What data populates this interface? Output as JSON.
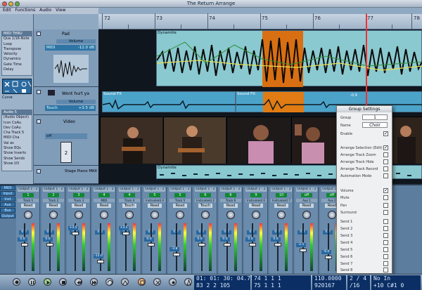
{
  "window": {
    "title": "The Return Arrange"
  },
  "menu": {
    "items": [
      "Edit",
      "Functions",
      "Audio",
      "View"
    ]
  },
  "ruler": {
    "bars": [
      "72",
      "73",
      "74",
      "75",
      "76",
      "77",
      "78"
    ]
  },
  "inspector": {
    "midi_thru": {
      "title": "MIDI THRU",
      "quant": "Qua 1/16-Note",
      "rows": [
        "Loop",
        "Transpose",
        "Velocity",
        "Dynamics",
        "Gate Time",
        "Delay"
      ]
    },
    "curve_label": "Curve",
    "audio": {
      "title": "Audio 5",
      "subtitle": "(Audio Object)",
      "icon_label": "Icon",
      "icon_value": "CoAu",
      "dev_label": "Dev",
      "dev_value": "CoAu",
      "cha_label": "Cha",
      "cha_value": "Track 5",
      "rows": [
        "MIDI Cha",
        "Val as",
        "Show EQs",
        "Show Inserts",
        "Show Sends",
        "Show I/O"
      ]
    }
  },
  "tracks": [
    {
      "name": "Pad",
      "fader_label": "Volume",
      "source": "MIDI",
      "value": "-12.0 dB"
    },
    {
      "name": "Wont hurt ya",
      "fader_label": "Volume",
      "source": "Touch",
      "value": "+3.5 dB"
    },
    {
      "name": "Video",
      "source": "off",
      "counter": "2"
    },
    {
      "name": "Stage Piano MKII"
    }
  ],
  "regions": {
    "dynamite_top": "Dynamite",
    "sound_fx": "Sound FX",
    "dynamite_bottom": "Dynamite",
    "fx_minus": "-0.9"
  },
  "mixer": {
    "side_buttons": [
      "MIDI",
      "Input",
      "Inst",
      "Aux",
      "Bus",
      "Output"
    ],
    "strips": [
      {
        "output": "Output 1 - 2",
        "name": "Track 1",
        "num": "1",
        "mode": "Read",
        "value": "0.0",
        "fader": "0.0"
      },
      {
        "output": "Output 1 - 2",
        "name": "Track 2",
        "num": "2",
        "mode": "Read",
        "value": "0.0",
        "fader": "0.0"
      },
      {
        "output": "Output 1 - 2",
        "name": "Track 3",
        "num": "3",
        "mode": "Read",
        "value": "0.0",
        "fader": "+3.5"
      },
      {
        "output": "Output 1 - 2",
        "name": "MIDI",
        "num": "4",
        "mode": "Read",
        "value": "0.0",
        "fader": "-12.0"
      },
      {
        "output": "Output 1 - 2",
        "name": "Track 4",
        "num": "4",
        "mode": "Touch",
        "value": "0.0",
        "fader": "+3.5"
      },
      {
        "output": "Output 1 - 2",
        "name": "Instrument 4",
        "num": "5",
        "mode": "Read",
        "value": "0.0",
        "fader": "0.0"
      },
      {
        "output": "Output 1 - 2",
        "name": "Track 5",
        "num": "5",
        "mode": "Read",
        "value": "0.0",
        "fader": "-3.8"
      },
      {
        "output": "Output 1 - 2",
        "name": "Instrument 2",
        "num": "6",
        "mode": "Touch",
        "value": "0.0",
        "fader": "0.0"
      },
      {
        "output": "Output 1 - 2",
        "name": "Track 6",
        "num": "6",
        "mode": "Read",
        "value": "0.0",
        "fader": "0.0"
      },
      {
        "output": "Output 1 - 2",
        "name": "Instrument 6",
        "num": "9",
        "mode": "Read",
        "value": "0.0",
        "fader": "0.0"
      },
      {
        "output": "Output 1 - 2",
        "name": "Instrument 7",
        "num": "10",
        "mode": "Read",
        "value": "0.0",
        "fader": "0.0"
      },
      {
        "output": "Output 1 - 2",
        "name": "Aux 1",
        "num": "off",
        "mode": "Read",
        "value": "0.0",
        "fader": "-2.5"
      },
      {
        "output": "Output 1 - 2",
        "name": "Aux 2",
        "num": "off",
        "mode": "Read",
        "value": "0.0",
        "fader": "-6.0"
      }
    ]
  },
  "group_settings": {
    "title": "Group Settings",
    "group_label": "Group",
    "group_value": "1",
    "name_label": "Name",
    "name_value": "Choir",
    "options": [
      {
        "label": "Enable",
        "checked": true
      },
      {
        "label": "Arrange Selection (Edit)",
        "checked": true
      },
      {
        "label": "Arrange Track Zoom",
        "checked": false
      },
      {
        "label": "Arrange Track Hide",
        "checked": false
      },
      {
        "label": "Arrange Track Record",
        "checked": false
      },
      {
        "label": "Automation Mode",
        "checked": false
      },
      {
        "label": "Volume",
        "checked": true
      },
      {
        "label": "Mute",
        "checked": false
      },
      {
        "label": "Pan",
        "checked": false
      },
      {
        "label": "Surround",
        "checked": false
      },
      {
        "label": "Send 1",
        "checked": false
      },
      {
        "label": "Send 2",
        "checked": false
      },
      {
        "label": "Send 3",
        "checked": false
      },
      {
        "label": "Send 4",
        "checked": false
      },
      {
        "label": "Send 5",
        "checked": false
      },
      {
        "label": "Send 6",
        "checked": false
      },
      {
        "label": "Send 7",
        "checked": false
      },
      {
        "label": "Send 8",
        "checked": false
      }
    ]
  },
  "transport": {
    "smpte_top": "01: 01: 30: 04.71",
    "smpte_bottom": "83   2   2  105",
    "pos_top": "74    1    1      1",
    "pos_bottom": "75    1    1      1",
    "tempo_top": "110.0000",
    "tempo_bottom": "920167",
    "sig_top": "2 / 4",
    "sig_bottom": "/16",
    "midi_top": "No In",
    "midi_bottom": "+10  C#1  0"
  },
  "colors": {
    "accent": "#2e75a6",
    "selection": "#e07a12",
    "background": "#8fa9c2"
  }
}
